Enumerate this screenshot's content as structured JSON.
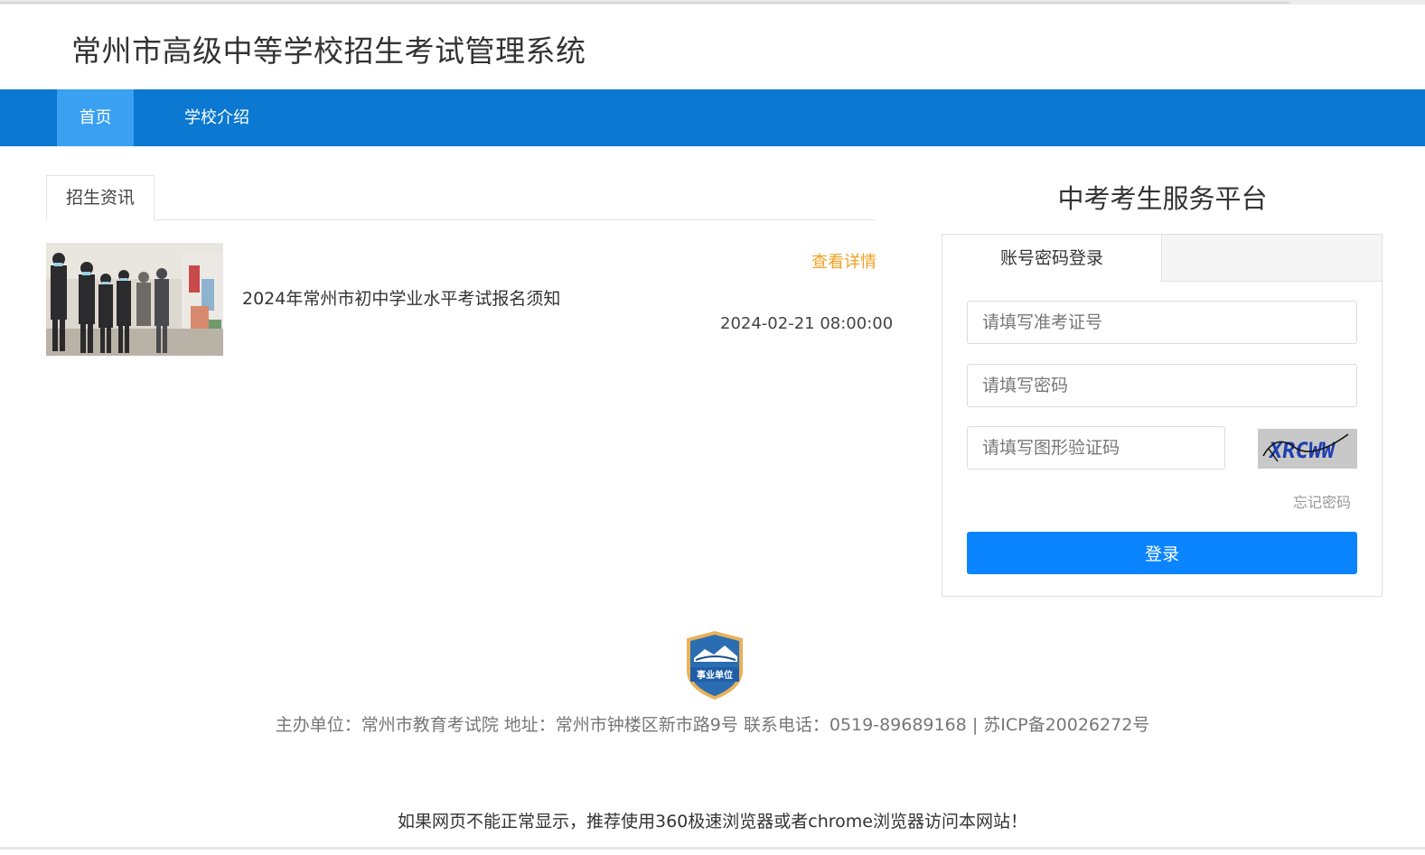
{
  "header": {
    "site_title": "常州市高级中等学校招生考试管理系统"
  },
  "nav": {
    "items": [
      {
        "label": "首页",
        "active": true
      },
      {
        "label": "学校介绍",
        "active": false
      }
    ]
  },
  "news": {
    "tab_label": "招生资讯",
    "items": [
      {
        "title": "2024年常州市初中学业水平考试报名须知",
        "more_label": "查看详情",
        "date": "2024-02-21 08:00:00"
      }
    ]
  },
  "login": {
    "platform_title": "中考考生服务平台",
    "tab_label": "账号密码登录",
    "id_placeholder": "请填写准考证号",
    "password_placeholder": "请填写密码",
    "captcha_placeholder": "请填写图形验证码",
    "captcha_text": "XRCWW",
    "forgot_label": "忘记密码",
    "submit_label": "登录"
  },
  "footer": {
    "badge_text": "事业单位",
    "info": "主办单位：常州市教育考试院 地址：常州市钟楼区新市路9号 联系电话：0519-89689168 | 苏ICP备20026272号",
    "tip": "如果网页不能正常显示，推荐使用360极速浏览器或者chrome浏览器访问本网站！"
  },
  "colors": {
    "nav_bg": "#0b78d1",
    "nav_active": "#3aa0f1",
    "link_orange": "#f0a020",
    "button_blue": "#0a84ff"
  }
}
